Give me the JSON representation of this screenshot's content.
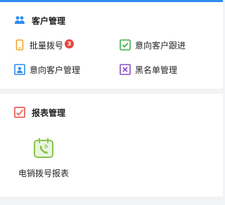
{
  "colors": {
    "accent_blue": "#2f8cf0",
    "orange": "#f5a623",
    "green": "#3cb34a",
    "purple": "#8a4fc7",
    "red": "#e8453c",
    "light_green": "#8bc34a"
  },
  "customer_section": {
    "title": "客户管理",
    "icon": "people-icon",
    "items": [
      {
        "label": "批量拨号",
        "icon": "phone-icon",
        "badge": "3"
      },
      {
        "label": "意向客户跟进",
        "icon": "checkbox-icon"
      },
      {
        "label": "意向客户管理",
        "icon": "contact-card-icon"
      },
      {
        "label": "黑名单管理",
        "icon": "blocked-icon"
      }
    ]
  },
  "report_section": {
    "title": "报表管理",
    "icon": "chart-icon",
    "tiles": [
      {
        "label": "电销拨号报表",
        "icon": "calendar-phone-icon"
      }
    ]
  }
}
